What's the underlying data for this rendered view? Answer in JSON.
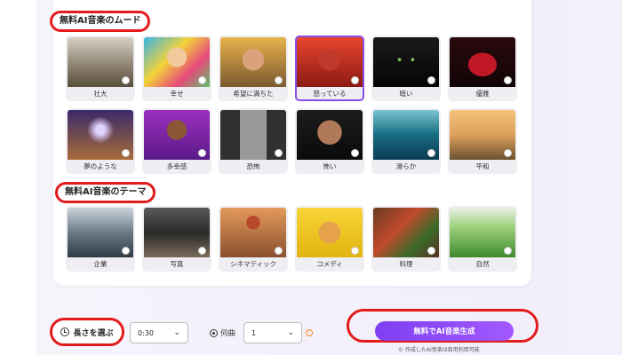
{
  "sections": {
    "mood_title": "無料AI音楽のムード",
    "theme_title": "無料AI音楽のテーマ"
  },
  "mood": [
    {
      "label": "壮大",
      "name": "mood-epic",
      "selected": false
    },
    {
      "label": "幸せ",
      "name": "mood-happy",
      "selected": false
    },
    {
      "label": "希望に満ちた",
      "name": "mood-hopeful",
      "selected": false
    },
    {
      "label": "怒っている",
      "name": "mood-angry",
      "selected": true
    },
    {
      "label": "暗い",
      "name": "mood-dark",
      "selected": false
    },
    {
      "label": "優雅",
      "name": "mood-elegant",
      "selected": false
    },
    {
      "label": "夢のような",
      "name": "mood-dreamy",
      "selected": false
    },
    {
      "label": "多幸感",
      "name": "mood-euphoric",
      "selected": false
    },
    {
      "label": "恐怖",
      "name": "mood-fear",
      "selected": false
    },
    {
      "label": "怖い",
      "name": "mood-scary",
      "selected": false
    },
    {
      "label": "滑らか",
      "name": "mood-smooth",
      "selected": false
    },
    {
      "label": "平和",
      "name": "mood-peaceful",
      "selected": false
    }
  ],
  "theme": [
    {
      "label": "企業",
      "name": "theme-corporate"
    },
    {
      "label": "写真",
      "name": "theme-photo"
    },
    {
      "label": "シネマティック",
      "name": "theme-cinematic"
    },
    {
      "label": "コメディ",
      "name": "theme-comedy"
    },
    {
      "label": "料理",
      "name": "theme-cooking"
    },
    {
      "label": "自然",
      "name": "theme-nature"
    }
  ],
  "controls": {
    "length_label": "長さを選ぶ",
    "length_value": "0:30",
    "songs_label": "何曲",
    "songs_value": "1",
    "generate_label": "無料でAI音楽生成",
    "footnote": "作成したAI音楽は商用利用可能"
  },
  "colors": {
    "accent": "#8a4ce6",
    "highlight": "#e31b1b"
  }
}
